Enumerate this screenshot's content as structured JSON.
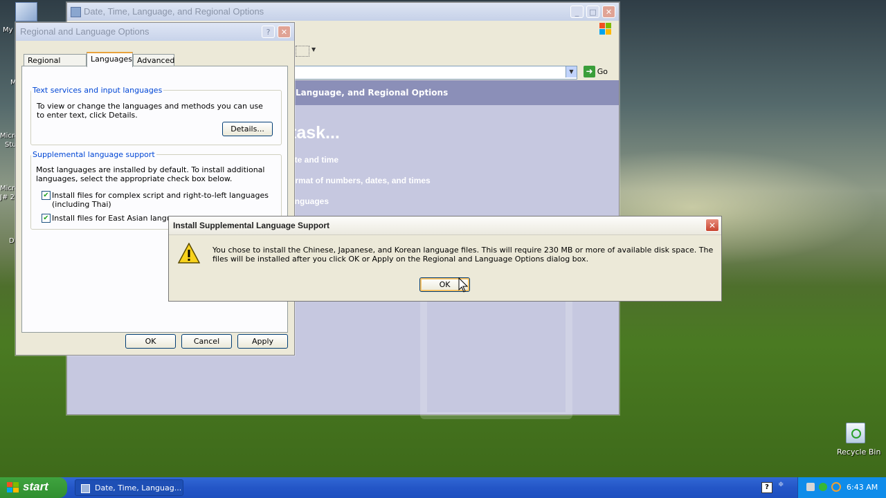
{
  "desktop": {
    "icons": [
      {
        "label": "My"
      },
      {
        "label": "M"
      },
      {
        "label": "Micro"
      },
      {
        "label": "Stu"
      },
      {
        "label": "Micro"
      },
      {
        "label": "J# 2"
      },
      {
        "label": "D"
      }
    ],
    "recycle_bin": "Recycle Bin"
  },
  "cp_window": {
    "title": "Date, Time, Language, and Regional Options",
    "go_label": "Go",
    "banner": "Language, and Regional Options",
    "pick_task": "task...",
    "links": [
      "ate and time",
      "ormat of numbers, dates, and times",
      "anguages"
    ]
  },
  "regional_dialog": {
    "title": "Regional and Language Options",
    "help": "?",
    "tabs": [
      "Regional Options",
      "Languages",
      "Advanced"
    ],
    "active_tab": 1,
    "text_services": {
      "legend": "Text services and input languages",
      "description": "To view or change the languages and methods you can use to enter text, click Details.",
      "details_button": "Details..."
    },
    "supplemental": {
      "legend": "Supplemental language support",
      "description": "Most languages are installed by default. To install additional languages, select the appropriate check box below.",
      "checkboxes": [
        {
          "label": "Install files for complex script and right-to-left languages (including Thai)",
          "checked": true
        },
        {
          "label": "Install files for East Asian languages",
          "checked": true
        }
      ]
    },
    "buttons": {
      "ok": "OK",
      "cancel": "Cancel",
      "apply": "Apply"
    }
  },
  "message_box": {
    "title": "Install Supplemental Language Support",
    "icon": "warning-icon",
    "message": "You chose to install the Chinese, Japanese, and Korean language files. This will require 230 MB or more of available disk space. The files will be installed after you click OK or Apply on the Regional and Language Options dialog box.",
    "ok_label": "OK"
  },
  "taskbar": {
    "start_label": "start",
    "task_label": "Date, Time, Languag...",
    "clock": "6:43 AM",
    "help": "?"
  },
  "colors": {
    "xp_blue": "#2456c7",
    "start_green": "#3fa33f",
    "legend_blue": "#0046d5"
  }
}
